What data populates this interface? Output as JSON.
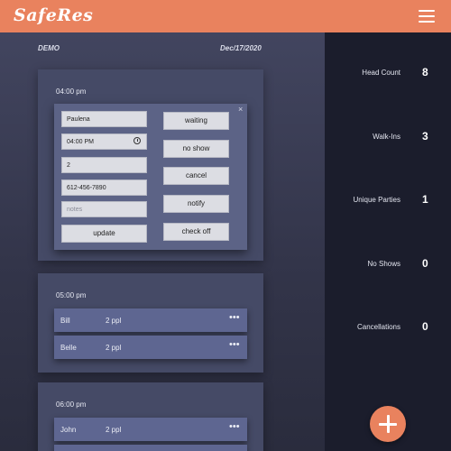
{
  "app": {
    "logo_text": "SafeRes"
  },
  "header": {
    "menu_icon": "hamburger-menu-icon"
  },
  "main": {
    "venue": "DEMO",
    "date": "Dec/17/2020",
    "slots": [
      {
        "time": "04:00 pm",
        "form": {
          "name": "Paulena",
          "time": "04:00 PM",
          "party_size": "2",
          "phone": "612-456-7890",
          "notes_placeholder": "notes",
          "update_label": "update",
          "actions": [
            "waiting",
            "no show",
            "cancel",
            "notify",
            "check off"
          ],
          "close_label": "×"
        }
      },
      {
        "time": "05:00 pm",
        "reservations": [
          {
            "name": "Bill",
            "size": "2 ppl",
            "more": "•••"
          },
          {
            "name": "Belle",
            "size": "2 ppl",
            "more": "•••"
          }
        ]
      },
      {
        "time": "06:00 pm",
        "reservations": [
          {
            "name": "John",
            "size": "2 ppl",
            "more": "•••"
          }
        ]
      }
    ]
  },
  "stats": [
    {
      "label": "Head Count",
      "value": "8"
    },
    {
      "label": "Walk-Ins",
      "value": "3"
    },
    {
      "label": "Unique Parties",
      "value": "1"
    },
    {
      "label": "No Shows",
      "value": "0"
    },
    {
      "label": "Cancellations",
      "value": "0"
    }
  ],
  "fab": {
    "icon": "plus-icon"
  },
  "colors": {
    "accent": "#e9825e",
    "sidebar": "#1b1d2c",
    "card": "#454a66",
    "row": "#5e6691"
  }
}
